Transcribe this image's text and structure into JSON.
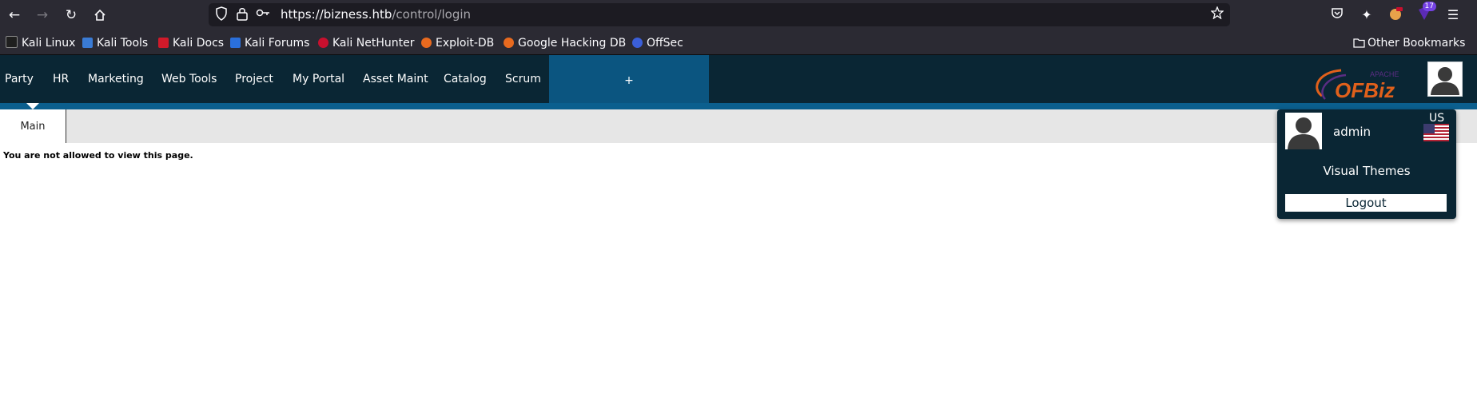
{
  "browser": {
    "url": {
      "host": "https://bizness.htb",
      "path": "/control/login"
    },
    "extensions_badge": "17",
    "colors": {
      "toolbar": "#2b2a33",
      "urlbar": "#1c1b22"
    }
  },
  "bookmarks": {
    "items": [
      {
        "label": "Kali Linux",
        "icon": "kali-dragon-icon"
      },
      {
        "label": "Kali Tools",
        "icon": "kali-tools-icon"
      },
      {
        "label": "Kali Docs",
        "icon": "kali-docs-icon"
      },
      {
        "label": "Kali Forums",
        "icon": "kali-forums-icon"
      },
      {
        "label": "Kali NetHunter",
        "icon": "kali-nethunter-icon"
      },
      {
        "label": "Exploit-DB",
        "icon": "exploit-db-icon"
      },
      {
        "label": "Google Hacking DB",
        "icon": "ghdb-icon"
      },
      {
        "label": "OffSec",
        "icon": "offsec-icon"
      }
    ],
    "other": "Other Bookmarks"
  },
  "app": {
    "menu": [
      "Party",
      "HR",
      "Marketing",
      "Web Tools",
      "Project",
      "My Portal",
      "Asset Maint",
      "Catalog",
      "Scrum"
    ],
    "plus": "+",
    "logo_small": "APACHE",
    "logo_main": "OFBiz",
    "subtab": "Main",
    "message": "You are not allowed to view this page.",
    "colors": {
      "header": "#0a2634",
      "stripe": "#0b5f8e",
      "plus_tab": "#0b5580"
    }
  },
  "user_menu": {
    "username": "admin",
    "locale": "US",
    "visual_themes": "Visual Themes",
    "logout": "Logout"
  }
}
